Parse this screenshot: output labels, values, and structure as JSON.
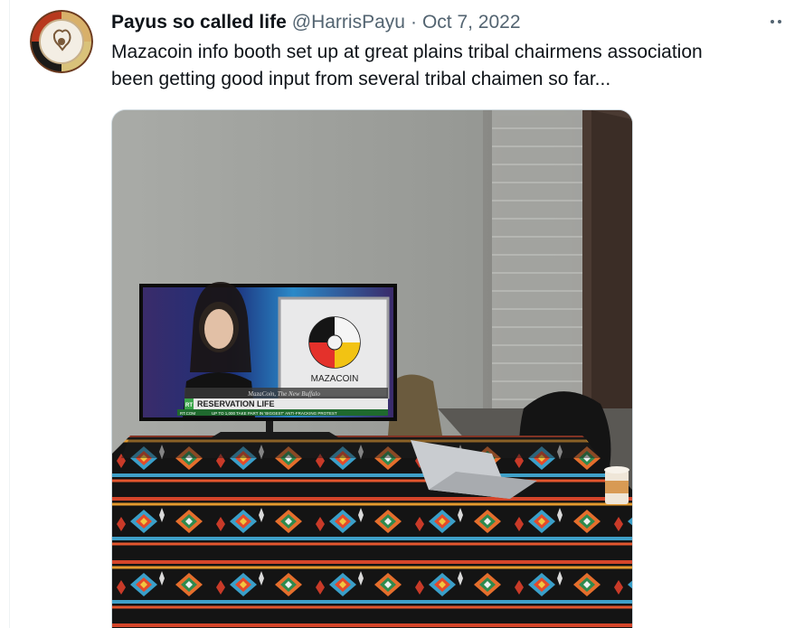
{
  "tweet": {
    "author": {
      "display_name": "Payus so called life",
      "handle": "@HarrisPayu",
      "avatar_icon": "medicine-wheel-avatar"
    },
    "separator": "·",
    "date": "Oct 7, 2022",
    "more_icon": "more-dots-icon",
    "text": "Mazacoin info booth set up at great plains tribal chairmens association\nbeen getting good input from several tribal chaimen so far...",
    "media": {
      "type": "photo",
      "tv_logo_label": "MAZACOIN",
      "tv_lower_third": "RESERVATION LIFE",
      "tv_channel_bug": "RT",
      "tv_caption": "MazaCoin, The New Buffalo",
      "tv_ticker": "UP TO 1,000 TAKE PART IN 'BIGGEST' ANTI-FRACKING PROTEST",
      "tv_ticker_channel": "RT.COM"
    }
  },
  "colors": {
    "text_primary": "#0f1419",
    "text_secondary": "#536471",
    "border": "#cfd9de"
  }
}
